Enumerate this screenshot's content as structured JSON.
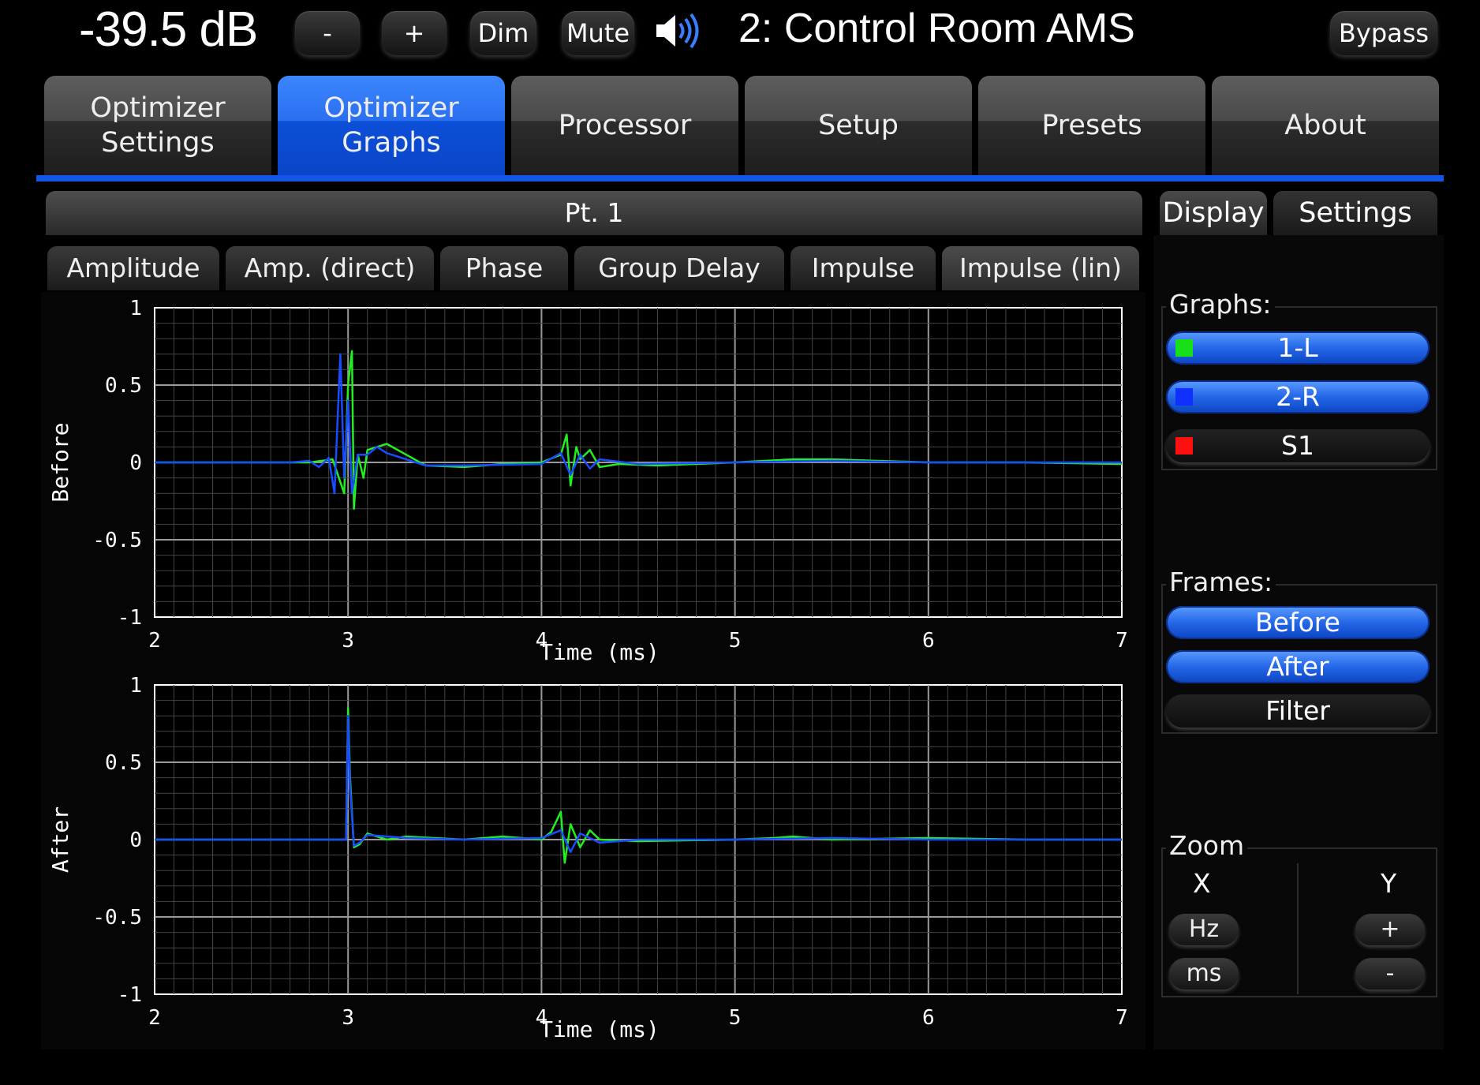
{
  "topbar": {
    "level": "-39.5 dB",
    "minus_label": "-",
    "plus_label": "+",
    "dim_label": "Dim",
    "mute_label": "Mute",
    "speaker_icon": "speaker-volume-icon",
    "room_title": "2: Control Room AMS",
    "bypass_label": "Bypass"
  },
  "tabs": [
    {
      "line1": "Optimizer",
      "line2": "Settings"
    },
    {
      "line1": "Optimizer",
      "line2": "Graphs"
    },
    {
      "line1": "Processor",
      "line2": ""
    },
    {
      "line1": "Setup",
      "line2": ""
    },
    {
      "line1": "Presets",
      "line2": ""
    },
    {
      "line1": "About",
      "line2": ""
    }
  ],
  "point": {
    "label": "Pt. 1"
  },
  "subtabs": [
    "Amplitude",
    "Amp. (direct)",
    "Phase",
    "Group Delay",
    "Impulse",
    "Impulse (lin)"
  ],
  "right_tabs": {
    "display": "Display",
    "settings": "Settings"
  },
  "graphs": {
    "label": "Graphs:",
    "items": [
      {
        "label": "1-L",
        "color": "#18e018"
      },
      {
        "label": "2-R",
        "color": "#1030ff"
      },
      {
        "label": "S1",
        "color": "#ff1010"
      }
    ]
  },
  "frames": {
    "label": "Frames:",
    "before": "Before",
    "after": "After",
    "filter": "Filter"
  },
  "zoom": {
    "label": "Zoom",
    "x_label": "X",
    "y_label": "Y",
    "hz": "Hz",
    "ms": "ms",
    "plus": "+",
    "minus": "-"
  },
  "colors": {
    "green": "#22ee22",
    "blue": "#1a4cff",
    "active_tab": "#1356e6"
  },
  "chart_data": [
    {
      "type": "line",
      "ylabel": "Before",
      "xlabel": "Time (ms)",
      "xlim": [
        2,
        7
      ],
      "ylim": [
        -1,
        1
      ],
      "xticks": [
        "2",
        "3",
        "4",
        "5",
        "6",
        "7"
      ],
      "yticks": [
        "1",
        "0.5",
        "0",
        "-0.5",
        "-1"
      ],
      "grid": true,
      "series": [
        {
          "color": "#22ee22",
          "x": [
            2,
            2.8,
            2.92,
            2.98,
            3.0,
            3.02,
            3.03,
            3.05,
            3.08,
            3.1,
            3.15,
            3.2,
            3.3,
            3.4,
            3.6,
            3.8,
            4.0,
            4.1,
            4.13,
            4.15,
            4.18,
            4.2,
            4.25,
            4.3,
            4.4,
            4.6,
            5.0,
            5.3,
            5.5,
            6.0,
            6.5,
            7.0
          ],
          "y": [
            0,
            0,
            0.02,
            -0.2,
            0.5,
            0.72,
            -0.3,
            0.05,
            -0.1,
            0.08,
            0.1,
            0.12,
            0.05,
            -0.02,
            -0.03,
            -0.01,
            0.0,
            0.05,
            0.18,
            -0.15,
            0.1,
            0.02,
            0.08,
            -0.03,
            -0.01,
            -0.02,
            0.0,
            0.02,
            0.02,
            0.0,
            0.0,
            -0.01
          ]
        },
        {
          "color": "#1a4cff",
          "x": [
            2,
            2.7,
            2.8,
            2.85,
            2.9,
            2.93,
            2.96,
            2.98,
            3.0,
            3.02,
            3.05,
            3.1,
            3.15,
            3.2,
            3.3,
            3.4,
            3.6,
            4.0,
            4.1,
            4.15,
            4.2,
            4.25,
            4.3,
            4.5,
            5.0,
            5.5,
            6.0,
            6.5,
            7.0
          ],
          "y": [
            0,
            0,
            0.01,
            -0.03,
            0.03,
            -0.2,
            0.7,
            -0.1,
            0.4,
            -0.2,
            0.05,
            0.05,
            0.1,
            0.06,
            0.02,
            -0.02,
            -0.02,
            -0.01,
            0.06,
            -0.08,
            0.05,
            -0.04,
            0.02,
            -0.01,
            0.0,
            0.01,
            0.0,
            0.0,
            0.0
          ]
        }
      ]
    },
    {
      "type": "line",
      "ylabel": "After",
      "xlabel": "Time (ms)",
      "xlim": [
        2,
        7
      ],
      "ylim": [
        -1,
        1
      ],
      "xticks": [
        "2",
        "3",
        "4",
        "5",
        "6",
        "7"
      ],
      "yticks": [
        "1",
        "0.5",
        "0",
        "-0.5",
        "-1"
      ],
      "grid": true,
      "series": [
        {
          "color": "#22ee22",
          "x": [
            2,
            2.95,
            2.99,
            3.0,
            3.01,
            3.03,
            3.06,
            3.1,
            3.2,
            3.3,
            3.6,
            3.8,
            4.0,
            4.05,
            4.1,
            4.12,
            4.15,
            4.2,
            4.25,
            4.3,
            4.5,
            5.0,
            5.2,
            5.3,
            5.5,
            6.0,
            6.5,
            7.0
          ],
          "y": [
            0,
            0,
            0.0,
            0.85,
            0.4,
            -0.05,
            -0.03,
            0.04,
            0.0,
            0.02,
            0.0,
            0.02,
            0.0,
            0.05,
            0.18,
            -0.15,
            0.1,
            -0.05,
            0.06,
            0.0,
            -0.01,
            0.0,
            0.01,
            0.02,
            0.0,
            0.01,
            0.0,
            0.0
          ]
        },
        {
          "color": "#1a4cff",
          "x": [
            2,
            2.95,
            2.99,
            3.0,
            3.01,
            3.03,
            3.06,
            3.1,
            3.3,
            3.6,
            4.0,
            4.1,
            4.15,
            4.2,
            4.3,
            4.5,
            5.0,
            5.5,
            6.0,
            6.5,
            7.0
          ],
          "y": [
            0,
            0,
            0.0,
            0.8,
            0.35,
            -0.04,
            -0.02,
            0.03,
            0.01,
            0.0,
            0.01,
            0.06,
            -0.08,
            0.04,
            -0.02,
            0.0,
            0.0,
            0.01,
            0.0,
            0.0,
            0.0
          ]
        }
      ]
    }
  ]
}
